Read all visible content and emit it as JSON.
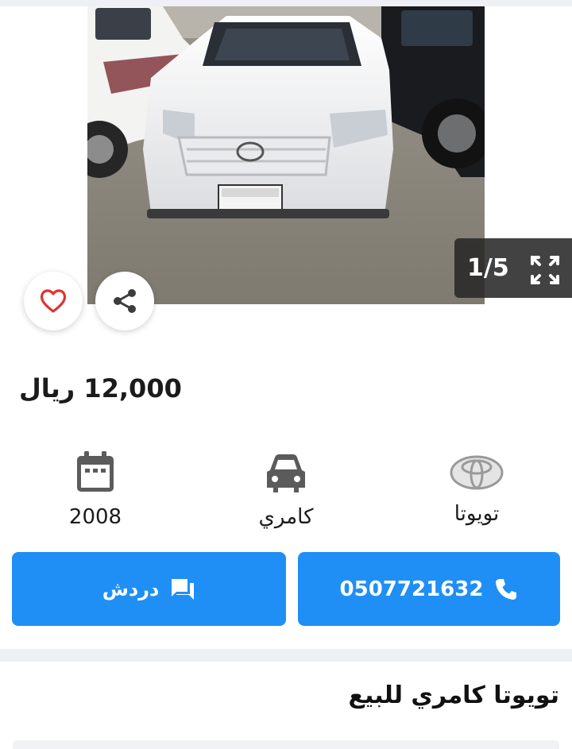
{
  "gallery": {
    "counter": "1/5",
    "photo_alt": "car-photo"
  },
  "listing": {
    "price": "12,000",
    "currency": "ريال",
    "title": "تويوتا كامري للبيع"
  },
  "specs": [
    {
      "icon": "calendar-icon",
      "label": "2008"
    },
    {
      "icon": "car-icon",
      "label": "كامري"
    },
    {
      "icon": "toyota-logo-icon",
      "label": "تويوتا"
    }
  ],
  "actions": {
    "chat_label": "دردش",
    "phone_number": "0507721632"
  },
  "colors": {
    "accent": "#1f8ff5",
    "heart": "#e0332f"
  }
}
